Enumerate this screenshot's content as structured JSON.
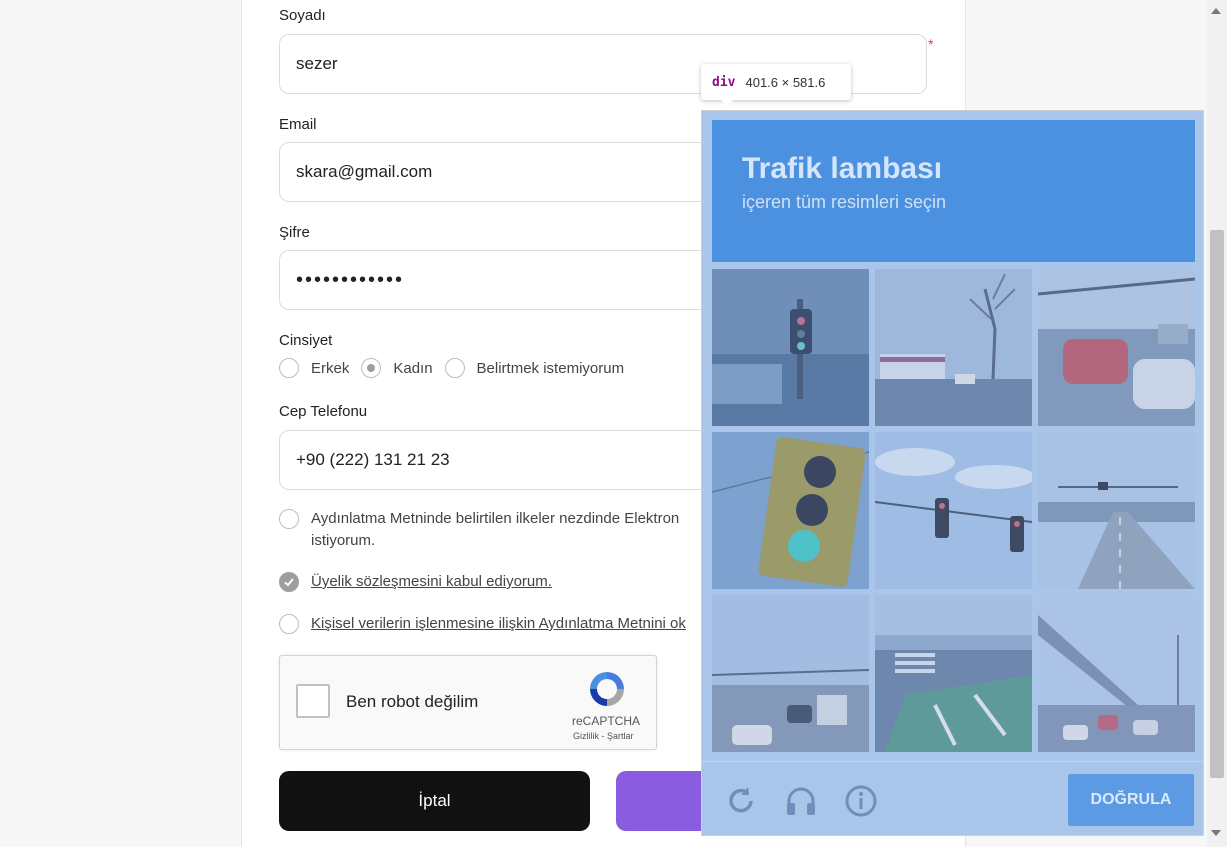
{
  "form": {
    "surname_label": "Soyadı",
    "surname_value": "sezer",
    "required_mark": "*",
    "email_label": "Email",
    "email_value": "skara@gmail.com",
    "password_label": "Şifre",
    "password_value": "••••••••••••",
    "gender_label": "Cinsiyet",
    "gender_options": [
      "Erkek",
      "Kadın",
      "Belirtmek istemiyorum"
    ],
    "gender_selected": "Kadın",
    "phone_label": "Cep Telefonu",
    "phone_value": "+90 (222) 131 21 23",
    "consent_1_line1": "Aydınlatma Metninde belirtilen ilkeler nezdinde Elektron",
    "consent_1_line2": "istiyorum.",
    "consent_2": "Üyelik sözleşmesini kabul ediyorum.",
    "consent_3": "Kişisel verilerin işlenmesine ilişkin Aydınlatma Metnini ok",
    "cancel_label": "İptal"
  },
  "recaptcha": {
    "label": "Ben robot değilim",
    "brand": "reCAPTCHA",
    "privacy": "Gizlilik",
    "separator": "-",
    "terms": "Şartlar"
  },
  "devtools_tooltip": {
    "tag": "div",
    "dimensions": "401.6 × 581.6"
  },
  "challenge": {
    "title": "Trafik lambası",
    "subtitle": "içeren tüm resimleri seçin",
    "verify_label": "DOĞRULA",
    "icons": [
      "reload-icon",
      "audio-icon",
      "info-icon"
    ],
    "tiles": [
      "traffic light on pole in front of building",
      "street with bus and bare tree",
      "highway with red car",
      "close-up traffic light",
      "traffic lights hanging over road under sky",
      "empty road with overhead signal",
      "road with traffic",
      "crosswalk with bike lane markings",
      "highway overpass with cars"
    ]
  },
  "colors": {
    "primary_button": "#8a5ce0",
    "cancel_button": "#111111",
    "challenge_header": "#4c90e0",
    "overlay": "#a9c6ea"
  }
}
